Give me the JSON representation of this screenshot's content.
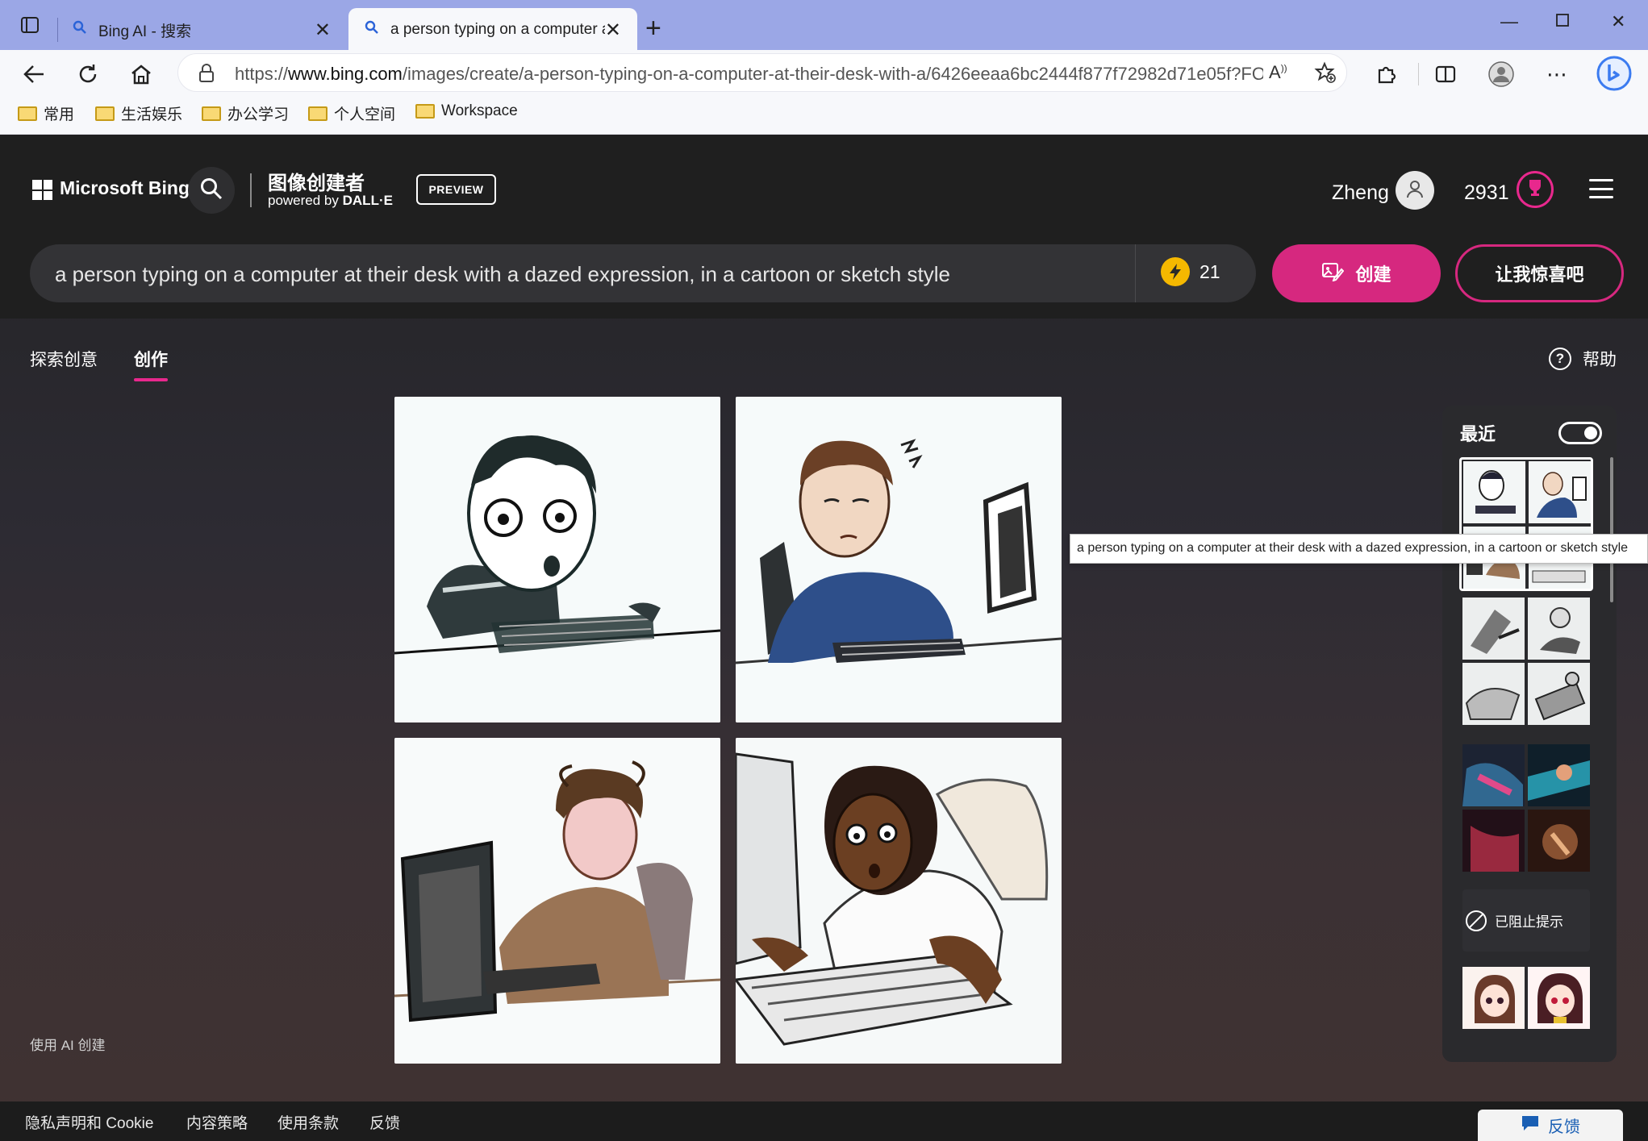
{
  "browser": {
    "tabs": [
      {
        "title": "Bing AI - 搜索"
      },
      {
        "title": "a person typing on a computer a"
      }
    ],
    "url_prefix": "https://",
    "url_host": "www.bing.com",
    "url_path": "/images/create/a-person-typing-on-a-computer-at-their-desk-with-a/6426eeaa6bc2444f877f72982d71e05f?FOR...",
    "bookmarks": [
      "常用",
      "生活娱乐",
      "办公学习",
      "个人空间",
      "Workspace"
    ]
  },
  "header": {
    "brand": "Microsoft Bing",
    "title": "图像创建者",
    "powered_prefix": "powered by ",
    "powered_brand": "DALL·E",
    "preview_badge": "PREVIEW",
    "user_name": "Zheng",
    "points": "2931"
  },
  "prompt": {
    "text": "a person typing on a computer at their desk with a dazed expression, in a cartoon or sketch style",
    "boosts": "21",
    "create_label": "创建",
    "surprise_label": "让我惊喜吧"
  },
  "subnav": {
    "explore": "探索创意",
    "create": "创作",
    "help": "帮助"
  },
  "recent": {
    "title": "最近",
    "blocked_label": "已阻止提示"
  },
  "tooltip": "a person typing on a computer at their desk with a dazed expression, in a cartoon or sketch style",
  "made_with_ai": "使用 AI 创建",
  "footer": {
    "links": [
      "隐私声明和 Cookie",
      "内容策略",
      "使用条款",
      "反馈"
    ],
    "feedback_button": "反馈"
  },
  "colors": {
    "accent": "#d6287f",
    "tabbar": "#9ba7e6",
    "boost": "#f5b800"
  },
  "icons": {
    "search": "magnifier",
    "create": "image-edit",
    "rewards": "trophy",
    "help": "question-circle",
    "blocked": "no-entry"
  }
}
